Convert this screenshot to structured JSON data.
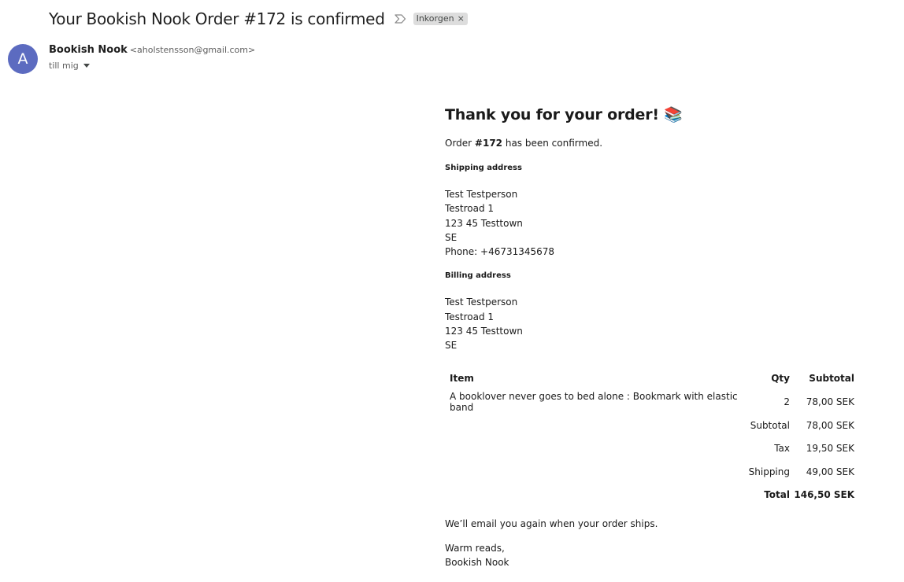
{
  "header": {
    "subject": "Your Bookish Nook Order #172 is confirmed",
    "label": "Inkorgen",
    "label_close": "×"
  },
  "sender": {
    "avatar_letter": "A",
    "avatar_color": "#5c6bc0",
    "name": "Bookish Nook",
    "email": "<aholstensson@gmail.com>",
    "to": "till mig"
  },
  "body": {
    "heading": "Thank you for your order! 📚",
    "order_prefix": "Order ",
    "order_number": "#172",
    "order_suffix": " has been confirmed.",
    "shipping": {
      "heading": "Shipping address",
      "lines": [
        "Test Testperson",
        "Testroad 1",
        "123 45 Testtown",
        "SE",
        "Phone: +46731345678"
      ]
    },
    "billing": {
      "heading": "Billing address",
      "lines": [
        "Test Testperson",
        "Testroad 1",
        "123 45 Testtown",
        "SE"
      ]
    },
    "table": {
      "headers": {
        "item": "Item",
        "qty": "Qty",
        "subtotal": "Subtotal"
      },
      "rows": [
        {
          "item": "A booklover never goes to bed alone : Bookmark with elastic band",
          "qty": "2",
          "subtotal": "78,00 SEK"
        }
      ],
      "summary": [
        {
          "label": "Subtotal",
          "value": "78,00 SEK"
        },
        {
          "label": "Tax",
          "value": "19,50 SEK"
        },
        {
          "label": "Shipping",
          "value": "49,00 SEK"
        },
        {
          "label": "Total",
          "value": "146,50 SEK"
        }
      ]
    },
    "footer": "We’ll email you again when your order ships.",
    "signoff": [
      "Warm reads,",
      "Bookish Nook"
    ]
  }
}
